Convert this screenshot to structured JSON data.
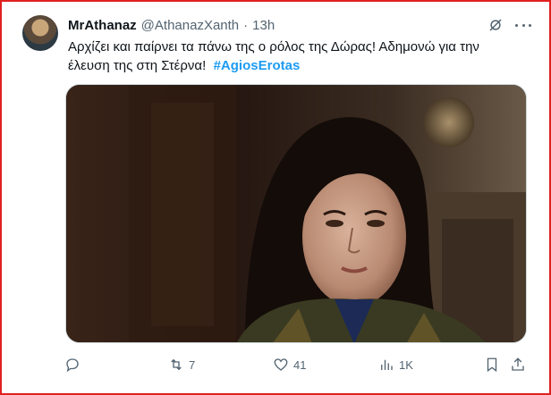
{
  "tweet": {
    "author_name": "MrAthanaz",
    "author_handle": "@AthanazXanth",
    "separator": "·",
    "time": "13h",
    "text_line1": "Αρχίζει και παίρνει τα πάνω της ο ρόλος της Δώρας! Αδημονώ για την",
    "text_line2": "έλευση της στη Στέρνα!",
    "hashtag": "#AgiosErotas",
    "icons": {
      "avatar": "profile-photo",
      "grok": "grok-icon",
      "more": "more-options-icon"
    }
  },
  "actions": {
    "reply": {
      "icon": "reply-icon",
      "count": ""
    },
    "retweet": {
      "icon": "retweet-icon",
      "count": "7"
    },
    "like": {
      "icon": "heart-icon",
      "count": "41"
    },
    "views": {
      "icon": "views-icon",
      "count": "1K"
    },
    "bookmark": {
      "icon": "bookmark-icon",
      "count": ""
    },
    "share": {
      "icon": "share-icon",
      "count": ""
    }
  },
  "colors": {
    "frame": "#e02020",
    "hashtag": "#1d9bf0",
    "text": "#0f1419",
    "muted": "#536471"
  }
}
